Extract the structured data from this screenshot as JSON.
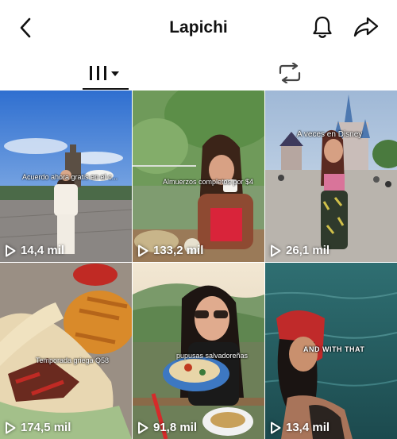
{
  "header": {
    "title": "Lapichi",
    "icons": {
      "back": "chevron-left-icon",
      "notifications": "bell-icon",
      "share": "share-arrow-icon"
    }
  },
  "tabs": [
    {
      "name": "videos-grid",
      "icon": "grid-bars-icon",
      "active": true
    },
    {
      "name": "reposts",
      "icon": "repost-icon",
      "active": false
    }
  ],
  "videos": [
    {
      "caption": "Acuerdo ahora gratis en el c...",
      "views": "14,4 mil"
    },
    {
      "caption": "Almuerzos completos por $4",
      "views": "133,2 mil"
    },
    {
      "caption": "A veces en Disney",
      "views": "26,1 mil"
    },
    {
      "caption": "Temporada griega Q58",
      "views": "174,5 mil"
    },
    {
      "caption": "pupusas salvadoreñas",
      "views": "91,8 mil"
    },
    {
      "caption": "AND WITH THAT",
      "views": "13,4 mil"
    }
  ]
}
